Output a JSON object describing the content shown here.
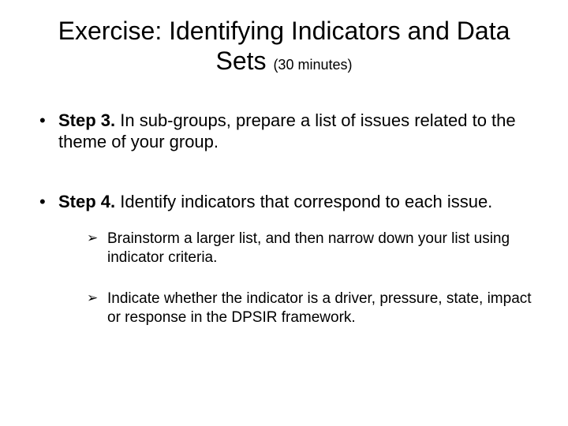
{
  "title": {
    "main": "Exercise: Identifying Indicators and Data Sets",
    "duration": "(30 minutes)"
  },
  "bullets": [
    {
      "label": "Step 3.",
      "text": " In sub-groups, prepare a list of issues related to the theme of your group.",
      "sub": []
    },
    {
      "label": "Step 4.",
      "text": " Identify indicators that correspond to each issue.",
      "sub": [
        "Brainstorm a larger list, and then narrow down your list using indicator criteria.",
        "Indicate whether the indicator is a driver, pressure, state, impact or response in the DPSIR framework."
      ]
    }
  ]
}
